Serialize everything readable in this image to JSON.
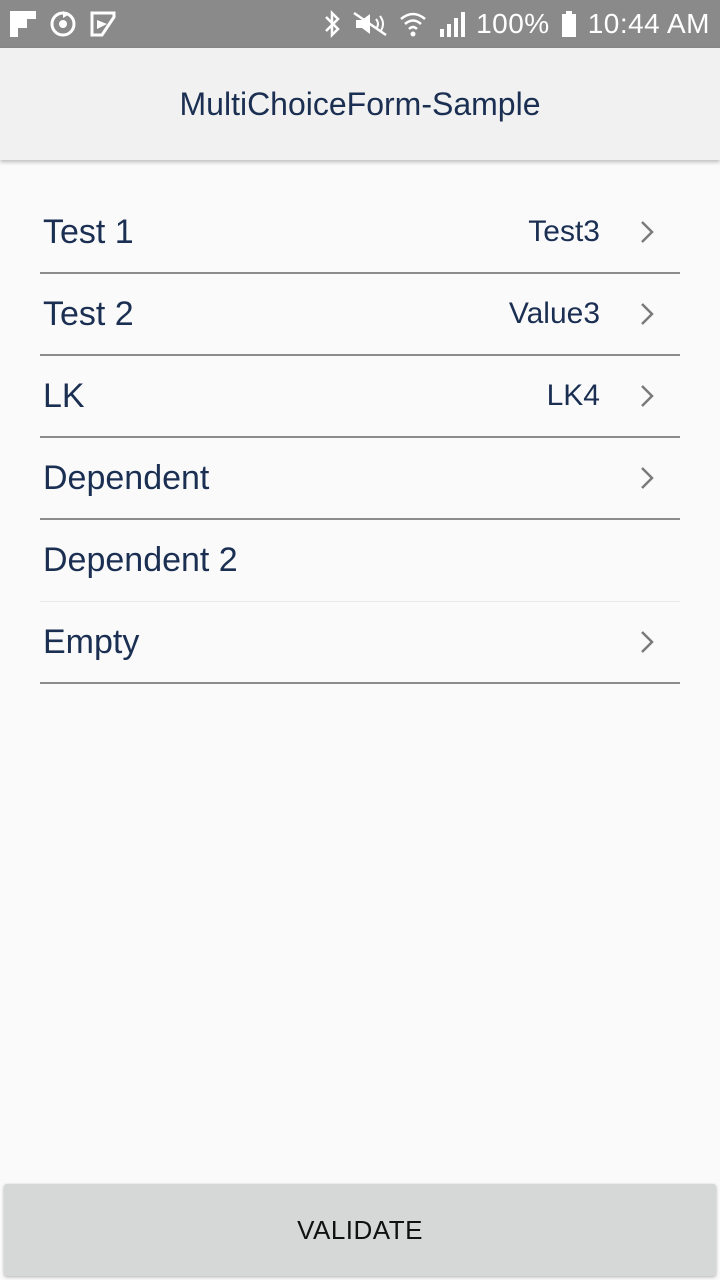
{
  "status_bar": {
    "left_icons": [
      "flipboard-icon",
      "sync-icon",
      "play-store-icon"
    ],
    "right_icons": [
      "bluetooth-icon",
      "mute-icon",
      "wifi-icon",
      "signal-icon"
    ],
    "battery": "100%",
    "time": "10:44 AM"
  },
  "app_bar": {
    "title": "MultiChoiceForm-Sample"
  },
  "form": {
    "rows": [
      {
        "label": "Test 1",
        "value": "Test3",
        "chevron": true
      },
      {
        "label": "Test 2",
        "value": "Value3",
        "chevron": true
      },
      {
        "label": "LK",
        "value": "LK4",
        "chevron": true
      },
      {
        "label": "Dependent",
        "value": "",
        "chevron": true
      },
      {
        "label": "Dependent 2",
        "value": "",
        "chevron": false
      },
      {
        "label": "Empty",
        "value": "",
        "chevron": true
      }
    ]
  },
  "validate_button": {
    "label": "VALIDATE"
  },
  "colors": {
    "status_bar_bg": "#8a8a8a",
    "app_bar_bg": "#f1f1f1",
    "text_primary": "#1b2f52",
    "button_bg": "#d6d7d7",
    "divider": "#8c8c8c"
  }
}
